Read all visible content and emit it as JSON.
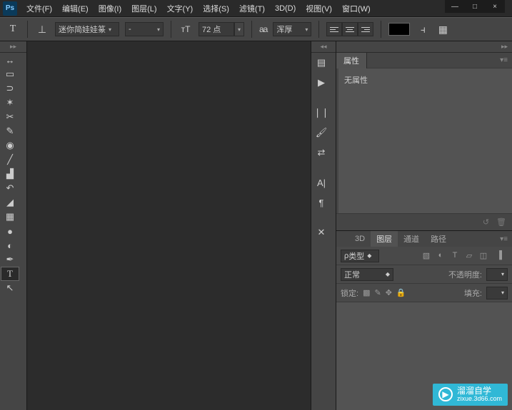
{
  "app": {
    "logo": "Ps"
  },
  "menu": [
    "文件(F)",
    "编辑(E)",
    "图像(I)",
    "图层(L)",
    "文字(Y)",
    "选择(S)",
    "滤镜(T)",
    "3D(D)",
    "视图(V)",
    "窗口(W)"
  ],
  "window": {
    "min": "—",
    "max": "□",
    "close": "×"
  },
  "optbar": {
    "tool": "T",
    "font": "迷你简娃娃篆",
    "style": "-",
    "size": "72 点",
    "aa": "浑厚",
    "aaLabel": "aa"
  },
  "prop": {
    "tab": "属性",
    "none": "无属性"
  },
  "layers": {
    "tabs": [
      "3D",
      "图层",
      "通道",
      "路径"
    ],
    "filter": "类型",
    "blend": "正常",
    "opacityLabel": "不透明度:",
    "lockLabel": "锁定:",
    "fillLabel": "填充:"
  },
  "watermark": {
    "title": "溜溜自学",
    "url": "zixue.3d66.com"
  },
  "midIcons": [
    "≡",
    "▶",
    "❘❘",
    "🖌",
    "⇄",
    "A|",
    "¶",
    "✕"
  ]
}
